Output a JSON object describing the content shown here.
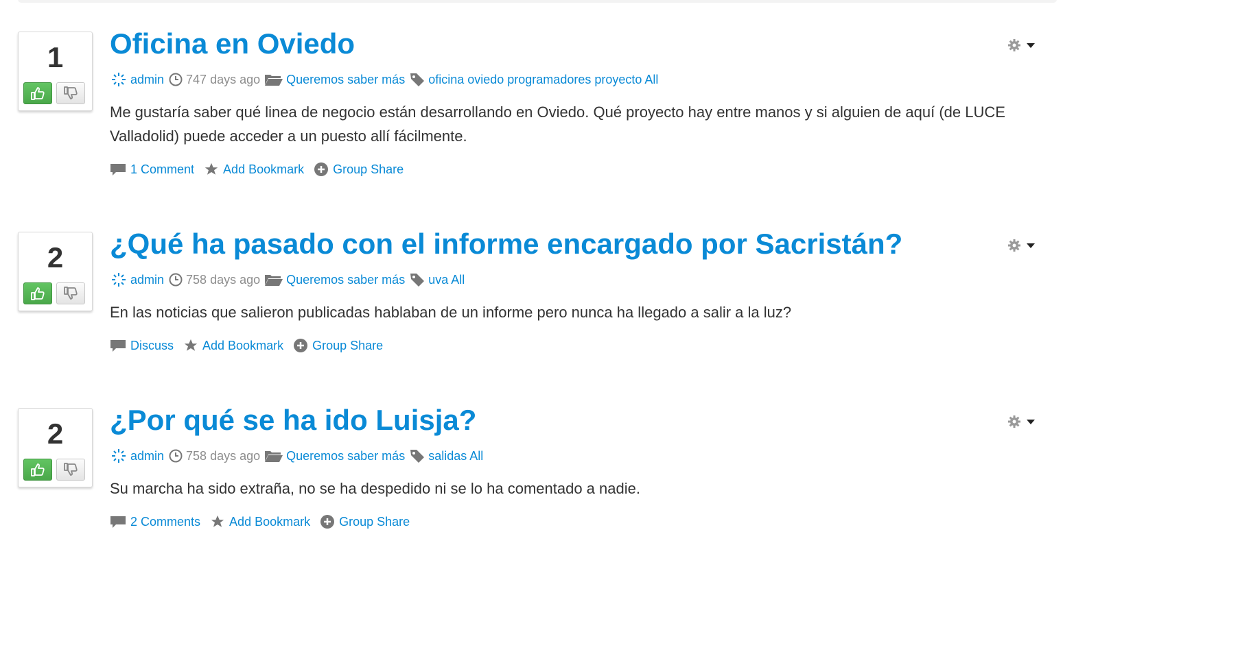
{
  "posts": [
    {
      "votes": "1",
      "title": "Oficina en Oviedo",
      "author": "admin",
      "time": "747 days ago",
      "category": "Queremos saber más",
      "tags": "oficina oviedo programadores proyecto All",
      "body": "Me gustaría saber qué linea de negocio están desarrollando en Oviedo. Qué proyecto hay entre manos y si alguien de aquí (de LUCE Valladolid) puede acceder a un puesto allí fácilmente.",
      "comments": "1 Comment",
      "bookmark": "Add Bookmark",
      "share": "Group Share"
    },
    {
      "votes": "2",
      "title": "¿Qué ha pasado con el informe encargado por Sacristán?",
      "author": "admin",
      "time": "758 days ago",
      "category": "Queremos saber más",
      "tags": "uva All",
      "body": "En las noticias que salieron publicadas hablaban de un informe pero nunca ha llegado a salir a la luz?",
      "comments": "Discuss",
      "bookmark": "Add Bookmark",
      "share": "Group Share"
    },
    {
      "votes": "2",
      "title": "¿Por qué se ha ido Luisja?",
      "author": "admin",
      "time": "758 days ago",
      "category": "Queremos saber más",
      "tags": "salidas All",
      "body": "Su marcha ha sido extraña, no se ha despedido ni se lo ha comentado a nadie.",
      "comments": "2 Comments",
      "bookmark": "Add Bookmark",
      "share": "Group Share"
    }
  ],
  "icons": {
    "avatar": "avatar-icon",
    "clock": "clock-icon",
    "folder": "folder-icon",
    "tag": "tag-icon",
    "comment": "comment-icon",
    "star": "star-icon",
    "plus": "plus-circle-icon",
    "gear": "gear-icon",
    "thumb_up": "thumbs-up-icon",
    "thumb_down": "thumbs-down-icon"
  },
  "colors": {
    "link": "#0a8ad6",
    "vote_up": "#4aa84a",
    "muted": "#8d8d8d",
    "text": "#333333"
  }
}
